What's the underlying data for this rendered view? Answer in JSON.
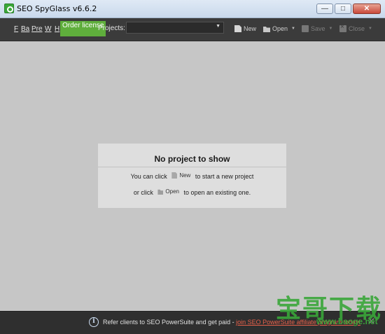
{
  "window": {
    "title": "SEO SpyGlass v6.6.2",
    "minimize_glyph": "—",
    "maximize_glyph": "□",
    "close_glyph": "✕"
  },
  "toolbar": {
    "menu": [
      "F",
      "Ba",
      "Pre",
      "W",
      "H"
    ],
    "order_license": "Order license",
    "projects_label": "Projects:",
    "projects_value": "",
    "new_label": "New",
    "open_label": "Open",
    "save_label": "Save",
    "close_label": "Close"
  },
  "panel": {
    "title": "No project to show",
    "line1_prefix": "You can click",
    "line1_button": "New",
    "line1_suffix": "to start a new project",
    "line2_prefix": "or click",
    "line2_button": "Open",
    "line2_suffix": "to open an existing one."
  },
  "bottom_bar": {
    "info_glyph": "i",
    "text": "Refer clients to SEO PowerSuite and get paid -",
    "link": "join SEO PowerSuite affiliate program today!",
    "close_glyph": "✕"
  },
  "watermark": {
    "chinese": "宝哥下载",
    "url": "www.baoge.net"
  },
  "colors": {
    "toolbar_bg": "#3b3b3b",
    "main_bg": "#c6c6c6",
    "order_license_bg": "#5fae3c",
    "link": "#e8604a",
    "watermark": "#3aa63a"
  }
}
